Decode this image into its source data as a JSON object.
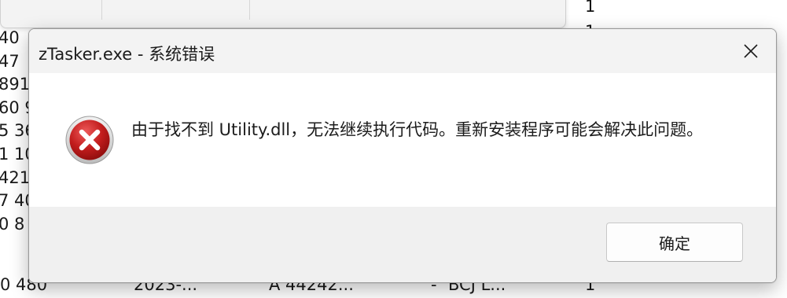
{
  "dialog": {
    "title": "zTasker.exe - 系统错误",
    "message": "由于找不到 Utility.dll，无法继续执行代码。重新安装程序可能会解决此问题。",
    "ok_label": "确定",
    "icon": "error-icon",
    "colors": {
      "icon_red": "#c21d1d",
      "titlebar_bg": "#f3f3f3",
      "footer_bg": "#f0f0f0"
    }
  },
  "background": {
    "left_column": [
      "40",
      "47",
      "891",
      "60 9",
      "5 36",
      "1 10",
      "421",
      "7 40",
      "0 8"
    ],
    "right_column_ones": [
      "1",
      "1"
    ],
    "bottom_row": {
      "col1": "0 480",
      "col2": "2023-...",
      "col3": "A  44242...",
      "col4": "-",
      "col5": "BCJ L...",
      "col6": "1"
    }
  }
}
